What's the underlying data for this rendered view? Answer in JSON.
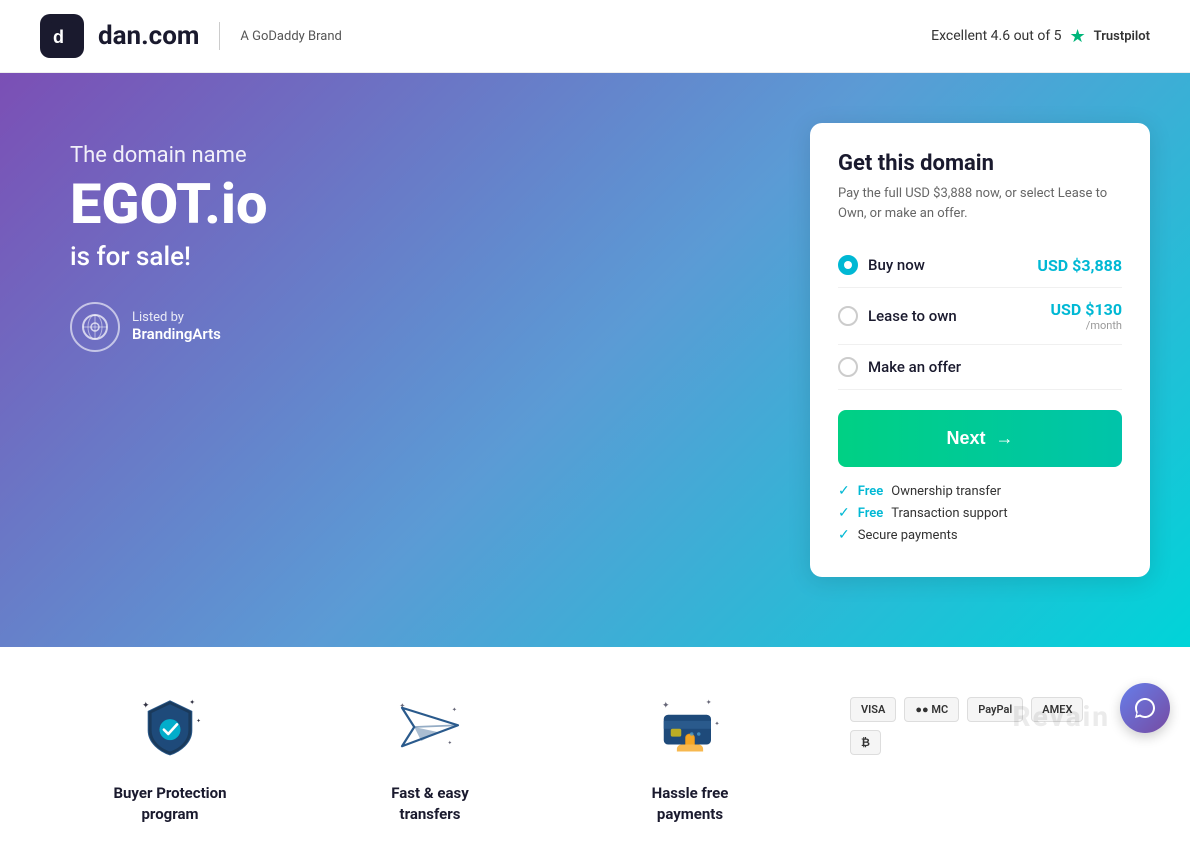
{
  "header": {
    "logo_letter": "d",
    "logo_text": "dan.com",
    "godaddy_label": "A GoDaddy Brand",
    "trustpilot_rating": "Excellent 4.6 out of 5",
    "trustpilot_name": "Trustpilot",
    "trustpilot_star": "★"
  },
  "hero": {
    "subtitle": "The domain name",
    "domain": "EGOT.io",
    "forsale": "is for sale!",
    "listed_by_label": "Listed by",
    "listed_by_name": "BrandingArts"
  },
  "card": {
    "title": "Get this domain",
    "description": "Pay the full USD $3,888 now, or select Lease to Own, or make an offer.",
    "option_buy_label": "Buy now",
    "option_buy_price": "USD $3,888",
    "option_lease_label": "Lease to own",
    "option_lease_price": "USD $130",
    "option_lease_sub": "/month",
    "option_offer_label": "Make an offer",
    "next_label": "Next",
    "next_arrow": "→",
    "free1_free": "Free",
    "free1_text": "Ownership transfer",
    "free2_free": "Free",
    "free2_text": "Transaction support",
    "free3_text": "Secure payments"
  },
  "features": [
    {
      "id": "buyer-protection",
      "title": "Buyer Protection program",
      "icon": "shield"
    },
    {
      "id": "fast-easy",
      "title": "Fast & easy transfers",
      "icon": "plane"
    },
    {
      "id": "hassle-free",
      "title": "Hassle free payments",
      "icon": "card"
    }
  ],
  "payment_icons": [
    "VISA",
    "MC",
    "PayPal",
    "AMEX",
    "BTC"
  ],
  "colors": {
    "accent": "#00b8d4",
    "green": "#00d084",
    "purple": "#7b4fb5",
    "cyan": "#00d4d8"
  }
}
